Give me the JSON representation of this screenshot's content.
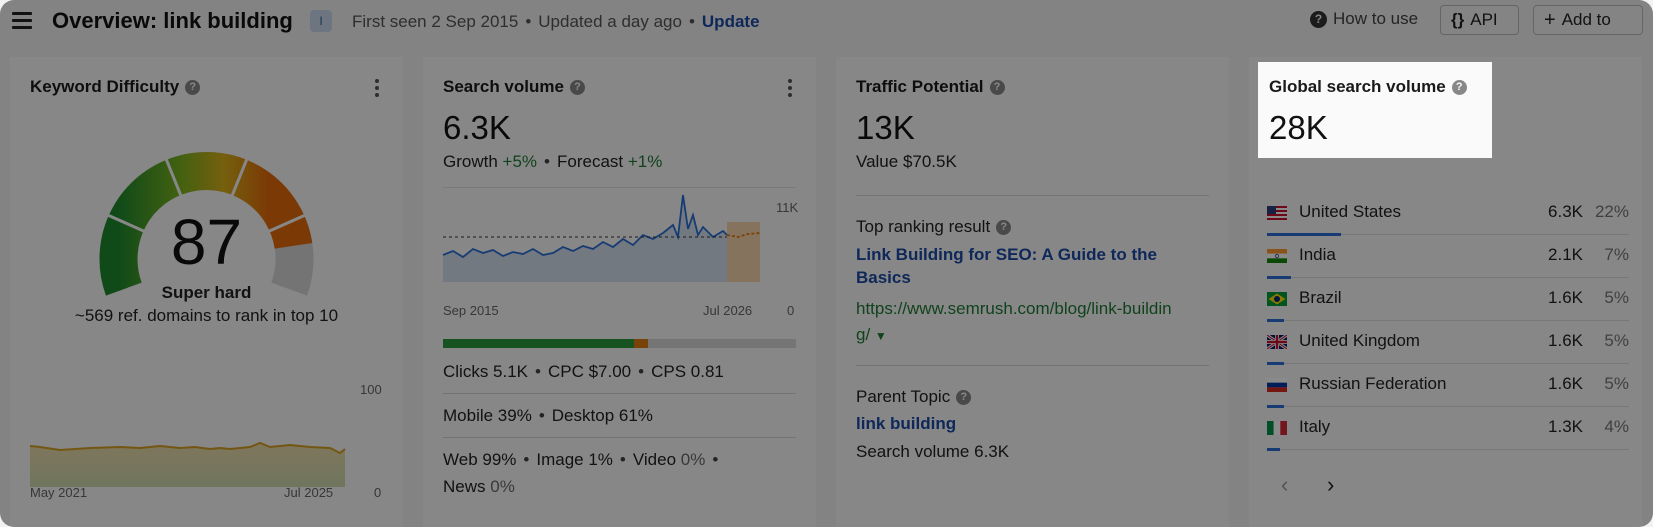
{
  "header": {
    "title": "Overview: link building",
    "badge": "I",
    "first_seen": "First seen 2 Sep 2015",
    "updated": "Updated a day ago",
    "update_label": "Update",
    "how_to_use": "How to use",
    "api_label": "API",
    "add_label": "Add to"
  },
  "kd": {
    "title": "Keyword Difficulty",
    "value": "87",
    "label": "Super hard",
    "sub": "~569 ref. domains to rank in top 10",
    "chart_start": "May 2021",
    "chart_end": "Jul 2025",
    "y_max": "100",
    "y_min": "0",
    "gauge_fraction": 0.87
  },
  "sv": {
    "title": "Search volume",
    "value": "6.3K",
    "growth_label": "Growth",
    "growth": "+5%",
    "forecast_label": "Forecast",
    "forecast": "+1%",
    "chart_start": "Sep 2015",
    "chart_end": "Jul 2026",
    "y_max": "11K",
    "y_min": "0",
    "clicks": "Clicks 5.1K",
    "cpc": "CPC $7.00",
    "cps": "CPS 0.81",
    "mobile": "Mobile 39%",
    "desktop": "Desktop 61%",
    "web": "Web 99%",
    "image": "Image 1%",
    "video_label": "Video",
    "video": "0%",
    "news_label": "News",
    "news": "0%",
    "colors": {
      "organic": "#2a9a3d",
      "paid": "#e07a10",
      "none": "#d8d8d8"
    }
  },
  "tp": {
    "title": "Traffic Potential",
    "value": "13K",
    "value_label": "Value $70.5K",
    "top_ranking_label": "Top ranking result",
    "top_result_title": "Link Building for SEO: A Guide to the Basics",
    "top_result_url_1": "https://www.semrush.com/blog/link-buildin",
    "top_result_url_2": "g/",
    "parent_topic_label": "Parent Topic",
    "parent_topic": "link building",
    "parent_volume": "Search volume 6.3K"
  },
  "gsv": {
    "title": "Global search volume",
    "value": "28K",
    "countries": [
      {
        "name": "United States",
        "volume": "6.3K",
        "pct": "22%",
        "share": 0.22
      },
      {
        "name": "India",
        "volume": "2.1K",
        "pct": "7%",
        "share": 0.07
      },
      {
        "name": "Brazil",
        "volume": "1.6K",
        "pct": "5%",
        "share": 0.05
      },
      {
        "name": "United Kingdom",
        "volume": "1.6K",
        "pct": "5%",
        "share": 0.05
      },
      {
        "name": "Russian Federation",
        "volume": "1.6K",
        "pct": "5%",
        "share": 0.05
      },
      {
        "name": "Italy",
        "volume": "1.3K",
        "pct": "4%",
        "share": 0.04
      }
    ]
  }
}
